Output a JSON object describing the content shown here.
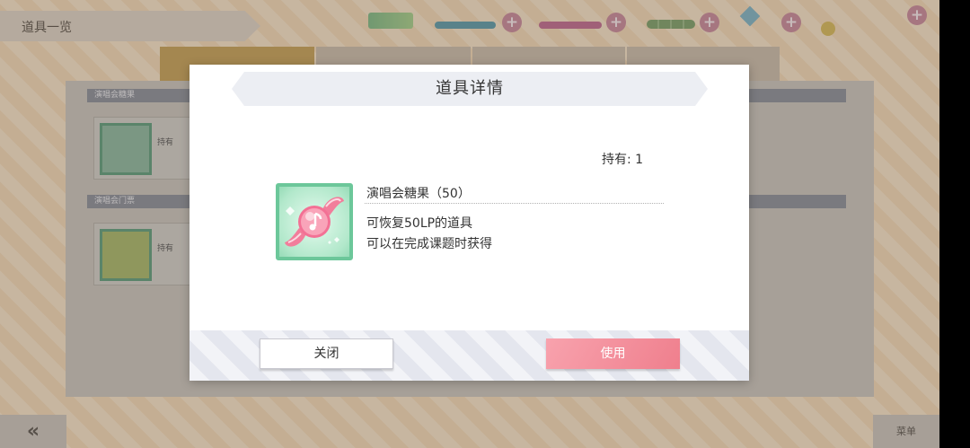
{
  "background": {
    "screen_title": "道具一览",
    "sections": [
      "演唱会糖果",
      "演唱会门票"
    ],
    "item_owned_label": "持有",
    "menu_label": "菜单"
  },
  "dialog": {
    "title": "道具详情",
    "owned": "持有: 1",
    "item": {
      "name": "演唱会糖果（50）",
      "description_line1": "可恢复50LP的道具",
      "description_line2": "可以在完成课题时获得",
      "icon": "candy-icon"
    },
    "buttons": {
      "close": "关闭",
      "use": "使用"
    }
  },
  "colors": {
    "use_button": "#ef7f8d",
    "item_frame": "#6cc79a",
    "candy": "#f06b8a"
  }
}
